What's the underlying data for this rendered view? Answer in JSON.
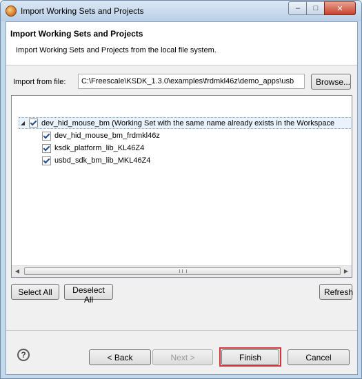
{
  "window": {
    "title": "Import Working Sets and Projects",
    "controls": {
      "minimize": "–",
      "maximize": "□",
      "close": "✕"
    }
  },
  "banner": {
    "title": "Import Working Sets and Projects",
    "description": "Import Working Sets and Projects from the local file system."
  },
  "import_from": {
    "label": "Import from file:",
    "value": "C:\\Freescale\\KSDK_1.3.0\\examples\\frdmkl46z\\demo_apps\\usb",
    "browse_label": "Browse..."
  },
  "tree": {
    "root": {
      "label": "dev_hid_mouse_bm (Working Set with the same name already exists in the Workspace",
      "checked": true,
      "expanded": true
    },
    "children": [
      {
        "label": "dev_hid_mouse_bm_frdmkl46z",
        "checked": true
      },
      {
        "label": "ksdk_platform_lib_KL46Z4",
        "checked": true
      },
      {
        "label": "usbd_sdk_bm_lib_MKL46Z4",
        "checked": true
      }
    ]
  },
  "selection_buttons": {
    "select_all": "Select All",
    "deselect_all": "Deselect All",
    "refresh": "Refresh"
  },
  "footer": {
    "help": "?",
    "back": "< Back",
    "next": "Next >",
    "finish": "Finish",
    "cancel": "Cancel"
  },
  "colors": {
    "highlight": "#d6343b",
    "close_button": "#c7412b"
  }
}
